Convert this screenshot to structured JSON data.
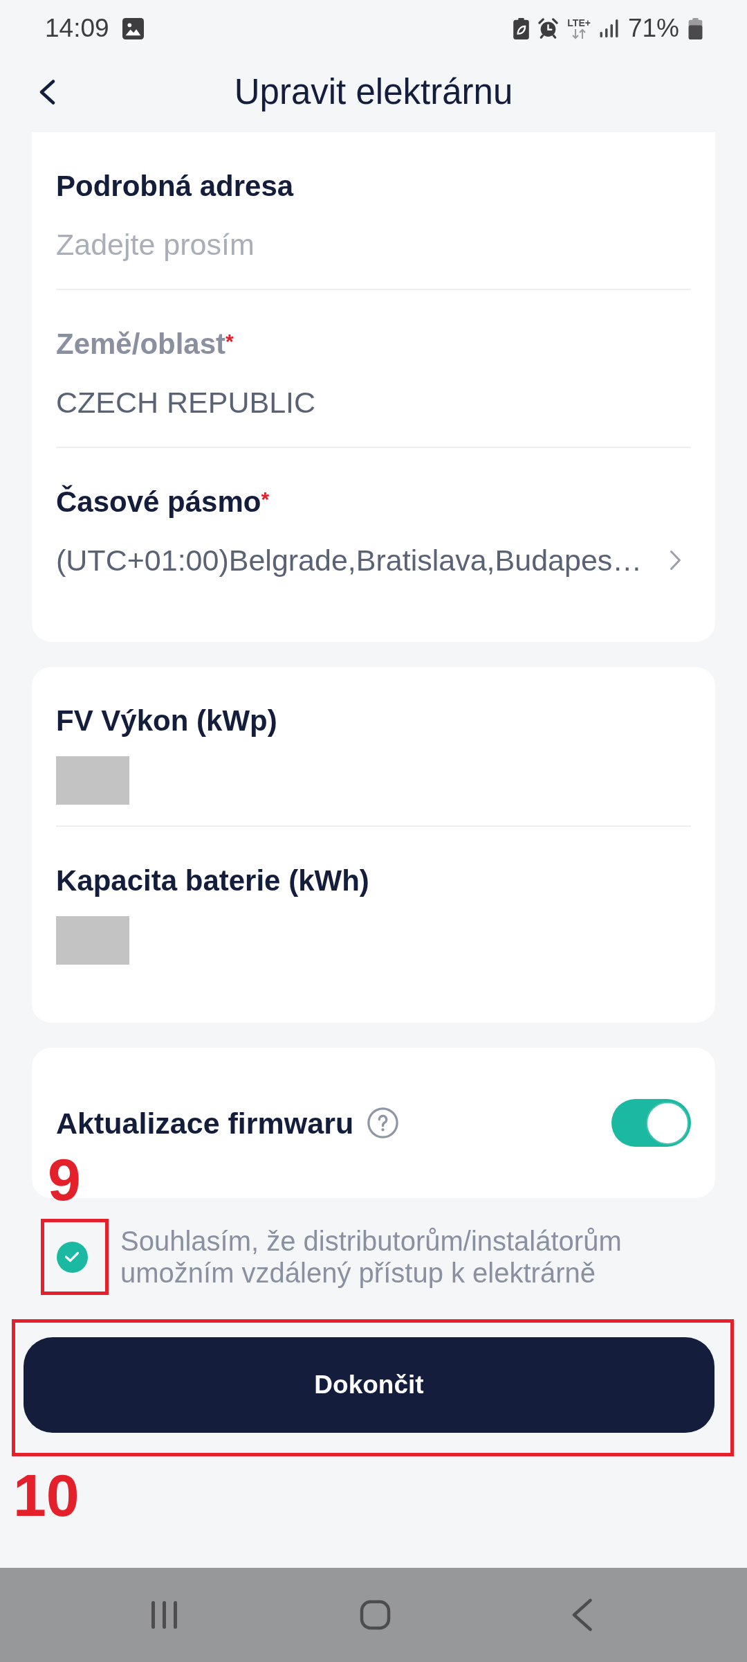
{
  "status_bar": {
    "time": "14:09",
    "network": "LTE+",
    "battery": "71%"
  },
  "header": {
    "title": "Upravit elektrárnu"
  },
  "address_section": {
    "fields": [
      {
        "kind": "input",
        "label": "Podrobná adresa",
        "placeholder": "Zadejte prosím",
        "disabled": false
      },
      {
        "kind": "display",
        "label": "Země/oblast",
        "required_mark": "*",
        "value": "CZECH REPUBLIC",
        "disabled": true
      },
      {
        "kind": "select",
        "label": "Časové pásmo",
        "required_mark": "*",
        "value": "(UTC+01:00)Belgrade,Bratislava,Budapes…",
        "disabled": false
      }
    ]
  },
  "system_section": {
    "fields": [
      {
        "kind": "redacted",
        "label": "FV Výkon (kWp)",
        "disabled": false
      },
      {
        "kind": "redacted",
        "label": "Kapacita baterie (kWh)",
        "disabled": false
      }
    ]
  },
  "firmware_setting": {
    "label": "Aktualizace firmwaru",
    "on": true
  },
  "consent": {
    "checked": true,
    "text": "Souhlasím, že distributorům/instalátorům umožním vzdálený přístup k elektrárně",
    "annotation": "9"
  },
  "submit_button": {
    "label": "Dokončit",
    "annotation": "10"
  }
}
